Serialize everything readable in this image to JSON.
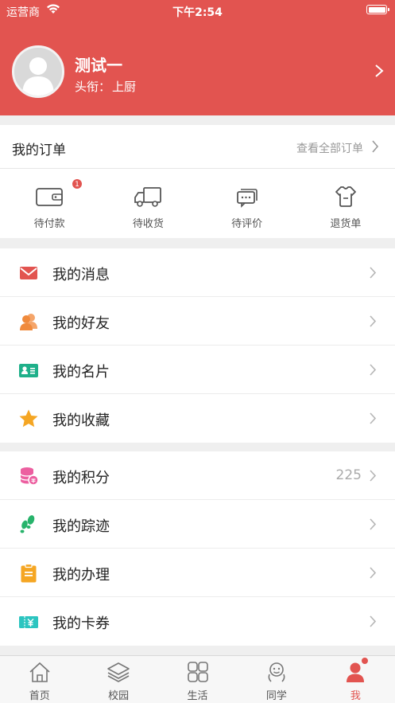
{
  "status_bar": {
    "carrier": "运营商",
    "time": "下午2:54"
  },
  "profile": {
    "name": "测试一",
    "title_label": "头衔：",
    "title_value": "上厨"
  },
  "orders": {
    "title": "我的订单",
    "view_all": "查看全部订单",
    "items": [
      {
        "label": "待付款",
        "icon": "wallet-icon",
        "badge": "1"
      },
      {
        "label": "待收货",
        "icon": "truck-icon"
      },
      {
        "label": "待评价",
        "icon": "comment-icon"
      },
      {
        "label": "退货单",
        "icon": "return-shirt-icon"
      }
    ]
  },
  "menu_group1": [
    {
      "label": "我的消息",
      "icon": "envelope-icon"
    },
    {
      "label": "我的好友",
      "icon": "friends-icon"
    },
    {
      "label": "我的名片",
      "icon": "business-card-icon"
    },
    {
      "label": "我的收藏",
      "icon": "star-icon"
    }
  ],
  "menu_group2": [
    {
      "label": "我的积分",
      "icon": "points-coins-icon",
      "value": "225"
    },
    {
      "label": "我的踪迹",
      "icon": "footprints-icon"
    },
    {
      "label": "我的办理",
      "icon": "clipboard-icon"
    },
    {
      "label": "我的卡券",
      "icon": "ticket-icon"
    }
  ],
  "tabbar": [
    {
      "label": "首页",
      "icon": "home-icon"
    },
    {
      "label": "校园",
      "icon": "layers-icon"
    },
    {
      "label": "生活",
      "icon": "grid-icon"
    },
    {
      "label": "同学",
      "icon": "classmate-icon"
    },
    {
      "label": "我",
      "icon": "person-icon",
      "active": true
    }
  ],
  "colors": {
    "accent": "#e25450",
    "envelope": "#e25450",
    "friends": "#f08a3c",
    "card": "#1fb08a",
    "star": "#f5a623",
    "points": "#ec5fa0",
    "footprints": "#27b36b",
    "clipboard": "#f5a623",
    "ticket": "#2cc5c0"
  }
}
